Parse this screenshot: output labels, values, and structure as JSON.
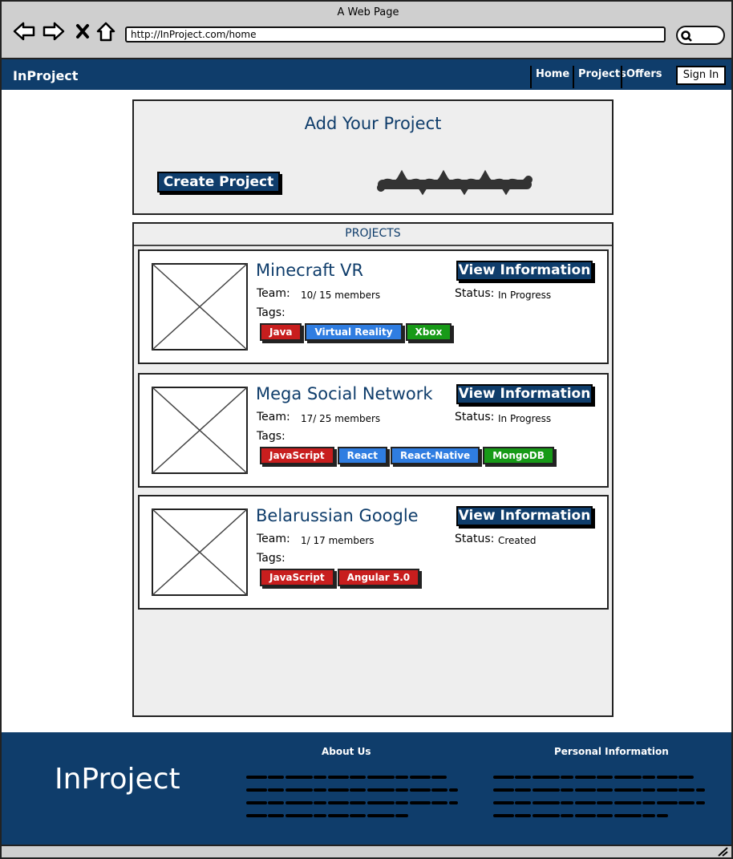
{
  "window": {
    "title": "A Web Page",
    "url": "http://InProject.com/home"
  },
  "navbar": {
    "brand": "InProject",
    "links": [
      {
        "label": "Home"
      },
      {
        "label": "Projects"
      },
      {
        "label": "Offers"
      }
    ],
    "sign_in": "Sign In"
  },
  "add_project": {
    "title": "Add Your Project",
    "create_button": "Create Project"
  },
  "projects": {
    "header": "PROJECTS",
    "team_label": "Team:",
    "status_label": "Status:",
    "tags_label": "Tags:",
    "view_button": "View Information",
    "items": [
      {
        "title": "Minecraft VR",
        "team": "10/ 15 members",
        "status": "In Progress",
        "tags": [
          {
            "label": "Java",
            "color": "red"
          },
          {
            "label": "Virtual Reality",
            "color": "blue"
          },
          {
            "label": "Xbox",
            "color": "green"
          }
        ]
      },
      {
        "title": "Mega Social Network",
        "team": "17/ 25 members",
        "status": "In Progress",
        "tags": [
          {
            "label": "JavaScript",
            "color": "red"
          },
          {
            "label": "React",
            "color": "blue"
          },
          {
            "label": "React-Native",
            "color": "blue"
          },
          {
            "label": "MongoDB",
            "color": "green"
          }
        ]
      },
      {
        "title": "Belarussian Google",
        "team": "1/ 17 members",
        "status": "Created",
        "tags": [
          {
            "label": "JavaScript",
            "color": "red"
          },
          {
            "label": "Angular 5.0",
            "color": "red"
          }
        ]
      }
    ]
  },
  "footer": {
    "brand": "InProject",
    "about_heading": "About Us",
    "personal_heading": "Personal Information"
  },
  "colors": {
    "primary": "#0f3d6b",
    "tag_red": "#c81e1e",
    "tag_blue": "#2f7de1",
    "tag_green": "#179a17",
    "chrome": "#cfcfcf",
    "panel": "#eeeeee"
  }
}
